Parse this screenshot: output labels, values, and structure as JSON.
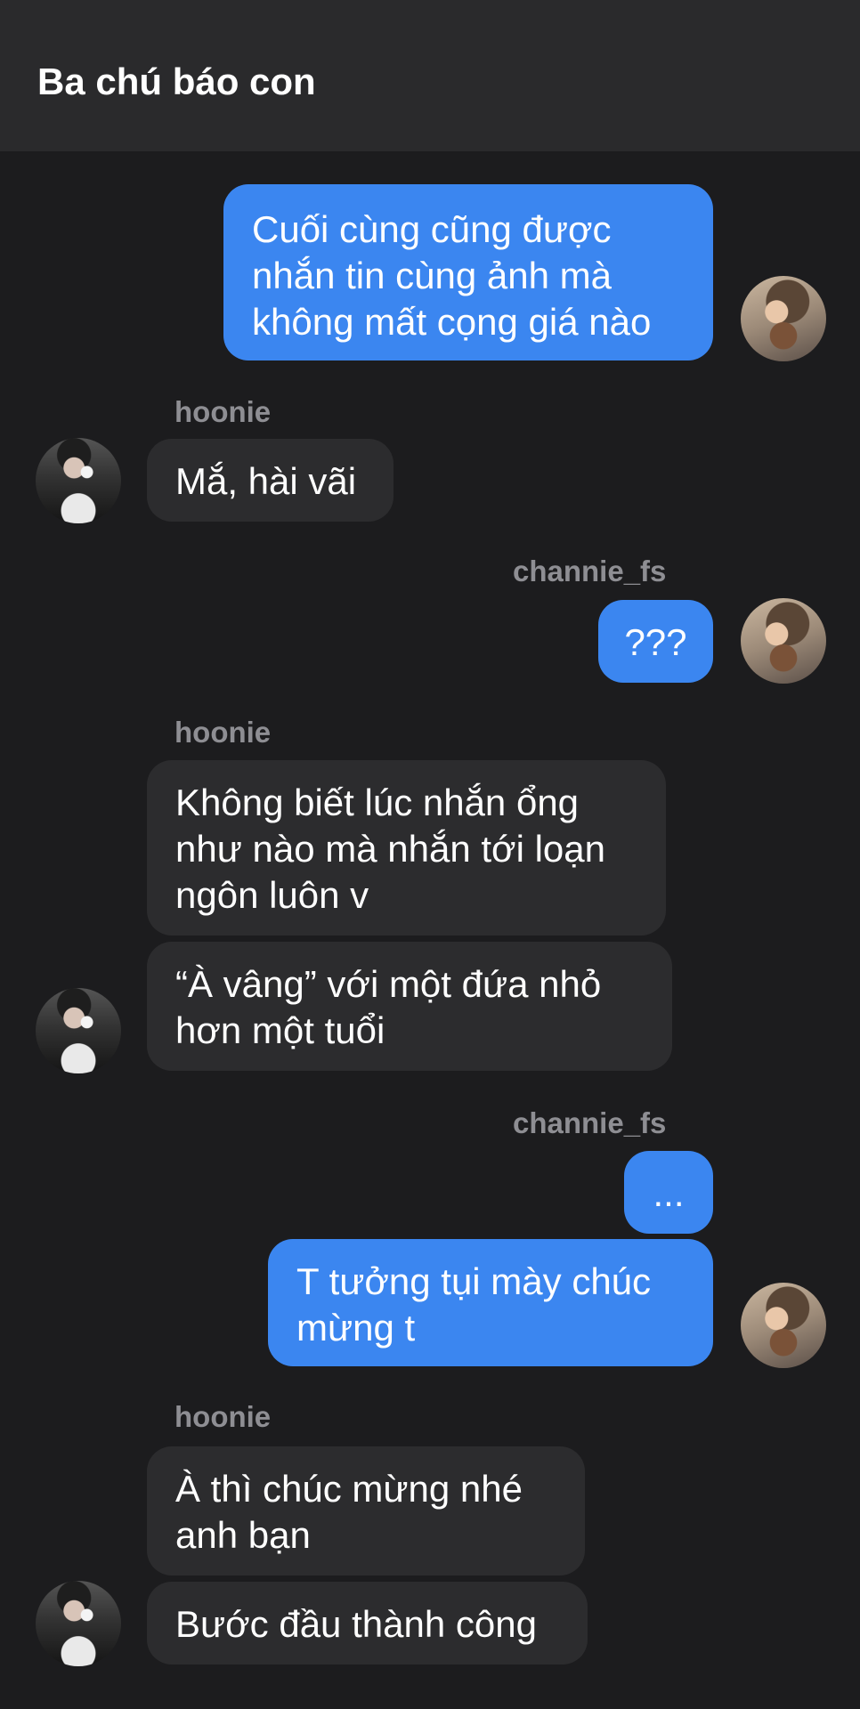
{
  "header": {
    "title": "Ba chú báo con"
  },
  "messages": [
    {
      "sender": "me",
      "text": "Cuối cùng cũng được\nnhắn tin cùng ảnh mà\nkhông mất cọng giá nào"
    },
    {
      "sender": "other",
      "name": "hoonie",
      "text": "Mắ, hài vãi"
    },
    {
      "sender": "me",
      "name": "channie_fs",
      "text": "???"
    },
    {
      "sender": "other",
      "name": "hoonie",
      "text": "Không biết lúc nhắn ổng\nnhư nào mà nhắn tới loạn\nngôn luôn v"
    },
    {
      "sender": "other",
      "text": "“À vâng” với một đứa nhỏ\nhơn một tuổi"
    },
    {
      "sender": "me",
      "name": "channie_fs",
      "text": "..."
    },
    {
      "sender": "me",
      "text": "T tưởng tụi mày chúc\nmừng t"
    },
    {
      "sender": "other",
      "name": "hoonie",
      "text": "À thì chúc mừng nhé\nanh bạn"
    },
    {
      "sender": "other",
      "text": "Bước đầu thành công"
    }
  ],
  "colors": {
    "background": "#1c1c1e",
    "header": "#2a2a2c",
    "outgoing_bubble": "#3b86f0",
    "incoming_bubble": "#2c2c2e",
    "sender_name": "#8e8e93"
  }
}
